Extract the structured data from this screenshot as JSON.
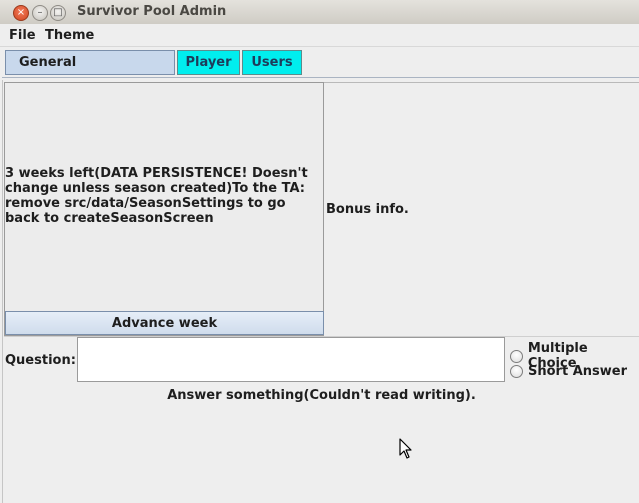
{
  "window": {
    "title": "Survivor Pool Admin",
    "close_glyph": "×",
    "min_glyph": "–",
    "max_glyph": "□"
  },
  "menu": {
    "items": [
      "File",
      "Theme"
    ]
  },
  "tabs": [
    {
      "label": "General",
      "selected": true
    },
    {
      "label": "Player",
      "selected": false
    },
    {
      "label": "Users",
      "selected": false
    }
  ],
  "general": {
    "info_text": "3 weeks left(DATA PERSISTENCE! Doesn't change unless season created)To the TA: remove src/data/SeasonSettings to go back to createSeasonScreen",
    "advance_button": "Advance week",
    "bonus_info": "Bonus info.",
    "question_label": "Question:",
    "question_value": "",
    "answer_types": [
      "Multiple Choice",
      "Short Answer"
    ],
    "answer_text": "Answer something(Couldn't read writing)."
  },
  "colors": {
    "selected_tab": "#c8d8ec",
    "unselected_tab": "#00eeee",
    "background": "#eeeeee"
  }
}
